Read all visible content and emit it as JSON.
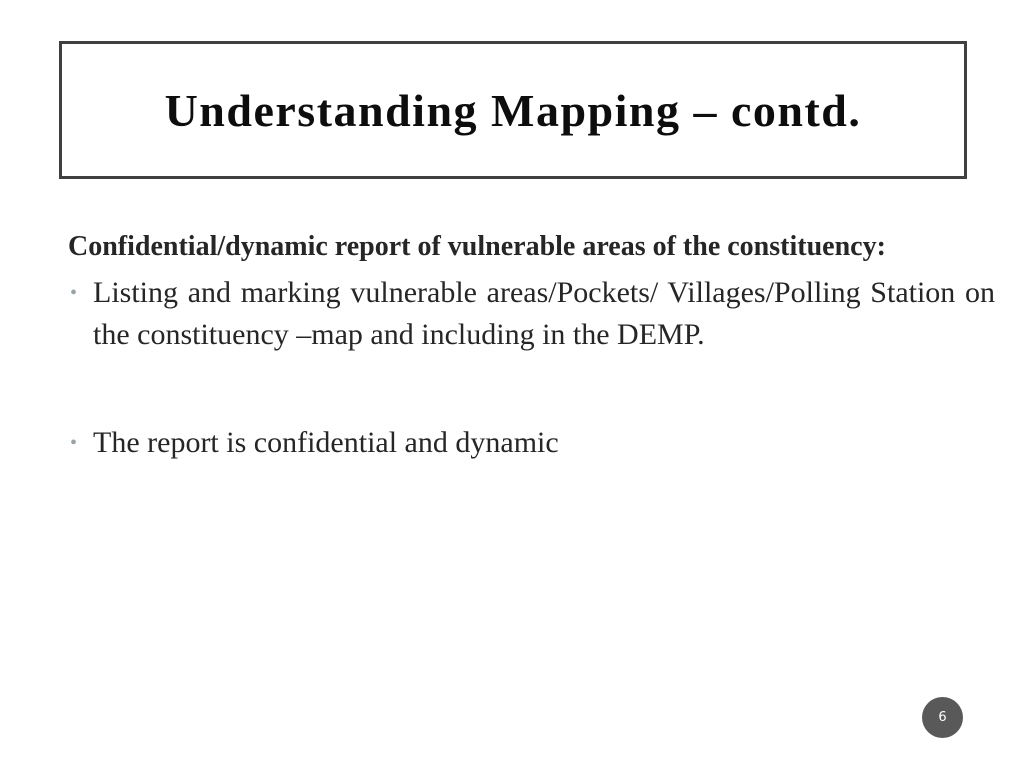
{
  "slide": {
    "title": "Understanding Mapping – contd.",
    "heading": "Confidential/dynamic report of vulnerable areas of the constituency:",
    "bullets": [
      {
        "icon": "bullet-dot",
        "text": "Listing and marking vulnerable areas/Pockets/ Villages/Polling Station on the constituency –map and including in the DEMP."
      },
      {
        "icon": "bullet-dot",
        "text": "The report is confidential and dynamic"
      }
    ],
    "page_number": "6"
  },
  "colors": {
    "title_border": "#404040",
    "text": "#262626",
    "bullet": "#9aa3a8",
    "page_badge": "#595959"
  }
}
